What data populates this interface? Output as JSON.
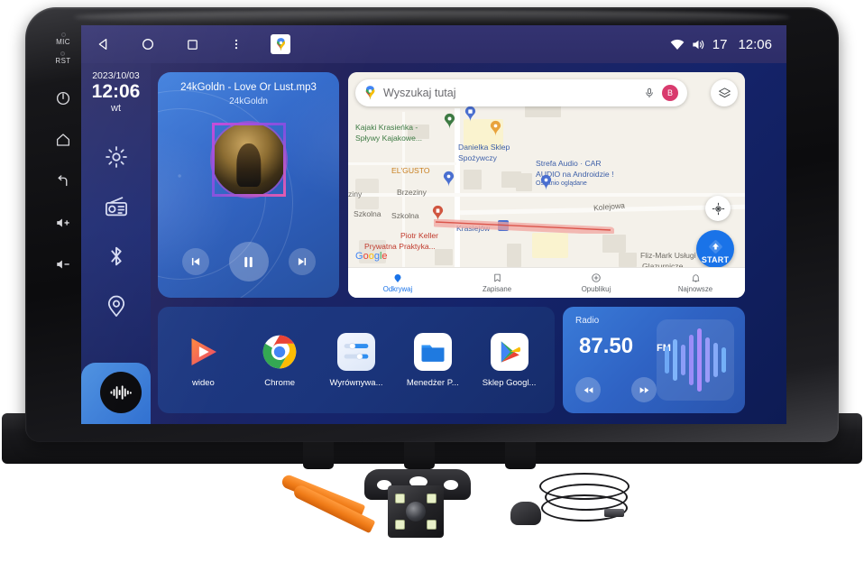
{
  "status_bar": {
    "nav": [
      {
        "name": "back",
        "icon": "triangle-left-icon"
      },
      {
        "name": "home",
        "icon": "circle-icon"
      },
      {
        "name": "recents",
        "icon": "square-icon"
      },
      {
        "name": "more",
        "icon": "dots-vertical-icon"
      },
      {
        "name": "maps-shortcut",
        "icon": "maps-pin-icon"
      }
    ],
    "wifi_icon": "wifi-icon",
    "volume_icon": "volume-icon",
    "volume_level": "17",
    "clock": "12:06"
  },
  "hardware_keys": [
    {
      "label": "MIC",
      "icon": "mic-hole-icon"
    },
    {
      "label": "RST",
      "icon": "reset-hole-icon"
    },
    {
      "label": "",
      "icon": "power-icon"
    },
    {
      "label": "",
      "icon": "home-icon"
    },
    {
      "label": "",
      "icon": "back-arrow-icon"
    },
    {
      "label": "",
      "icon": "volume-up-icon"
    },
    {
      "label": "",
      "icon": "volume-down-icon"
    }
  ],
  "clock_widget": {
    "date": "2023/10/03",
    "time": "12:06",
    "weekday": "wt"
  },
  "dock": {
    "items": [
      {
        "name": "settings",
        "icon": "gear-icon"
      },
      {
        "name": "radio",
        "icon": "radio-icon"
      },
      {
        "name": "bluetooth",
        "icon": "bluetooth-icon"
      },
      {
        "name": "navigation",
        "icon": "location-pin-icon"
      }
    ],
    "music_fab_icon": "waveform-icon"
  },
  "media": {
    "title": "24kGoldn - Love Or Lust.mp3",
    "artist": "24kGoldn",
    "controls": [
      {
        "name": "previous",
        "icon": "skip-previous-icon"
      },
      {
        "name": "pause",
        "icon": "pause-icon"
      },
      {
        "name": "next",
        "icon": "skip-next-icon"
      }
    ]
  },
  "map": {
    "search_placeholder": "Wyszukaj tutaj",
    "search_icon": "maps-pin-icon",
    "mic_icon": "microphone-icon",
    "avatar_initial": "B",
    "layers_icon": "layers-icon",
    "locate_icon": "my-location-icon",
    "start_label": "START",
    "watermark": "Google",
    "labels": [
      {
        "text": "Kajaki Krasieńka -",
        "color": "green"
      },
      {
        "text": "Spływy Kajakowe...",
        "color": "green"
      },
      {
        "text": "Danielka Sklep",
        "color": "blue"
      },
      {
        "text": "Spożywczy",
        "color": "blue"
      },
      {
        "text": "Strefa Audio · CAR",
        "color": "blue"
      },
      {
        "text": "AUDIO na Androidzie !",
        "color": "blue"
      },
      {
        "text": "Ostatnio oglądane",
        "color": "blue"
      },
      {
        "text": "EL'GUSTO",
        "color": "orange"
      },
      {
        "text": "Brzeziny",
        "color": "grey"
      },
      {
        "text": "ziny",
        "color": "grey"
      },
      {
        "text": "Szkolna",
        "color": "grey"
      },
      {
        "text": "Szkolna",
        "color": "grey"
      },
      {
        "text": "Kolejowa",
        "color": "grey"
      },
      {
        "text": "Krasiejów",
        "color": "blue"
      },
      {
        "text": "Piotr Keller",
        "color": "red"
      },
      {
        "text": "Prywatna Praktyka...",
        "color": "red"
      },
      {
        "text": "Fliz-Mark Usługi",
        "color": "grey"
      },
      {
        "text": "Glazurnicze",
        "color": "grey"
      }
    ],
    "bottom_nav": [
      {
        "label": "Odkrywaj",
        "icon": "explore-pin-icon",
        "active": true
      },
      {
        "label": "Zapisane",
        "icon": "bookmark-icon",
        "active": false
      },
      {
        "label": "Opublikuj",
        "icon": "plus-circle-icon",
        "active": false
      },
      {
        "label": "Najnowsze",
        "icon": "bell-icon",
        "active": false
      }
    ]
  },
  "apps": [
    {
      "label": "wideo",
      "icon": "video-play-icon"
    },
    {
      "label": "Chrome",
      "icon": "chrome-icon"
    },
    {
      "label": "Wyrównywa...",
      "icon": "equalizer-sliders-icon"
    },
    {
      "label": "Menedżer P...",
      "icon": "folder-icon"
    },
    {
      "label": "Sklep Googl...",
      "icon": "play-store-icon"
    }
  ],
  "radio": {
    "label": "Radio",
    "frequency": "87.50",
    "unit": "FM",
    "controls": [
      {
        "name": "seek-backward",
        "icon": "rewind-icon"
      },
      {
        "name": "seek-forward",
        "icon": "fast-forward-icon"
      }
    ],
    "eq_bars": [
      30,
      46,
      34,
      56,
      70,
      50,
      38,
      28
    ]
  },
  "accessories": [
    {
      "name": "pry-tools",
      "label": "plastic pry tool set"
    },
    {
      "name": "reverse-camera",
      "label": "rear view camera with bracket"
    },
    {
      "name": "external-microphone",
      "label": "external microphone with cable"
    }
  ],
  "colors": {
    "accent_blue": "#1a73e8",
    "media_blue": "#2f63c4",
    "status_bar": "#2d2d68",
    "screen_bg": "#15246b"
  }
}
